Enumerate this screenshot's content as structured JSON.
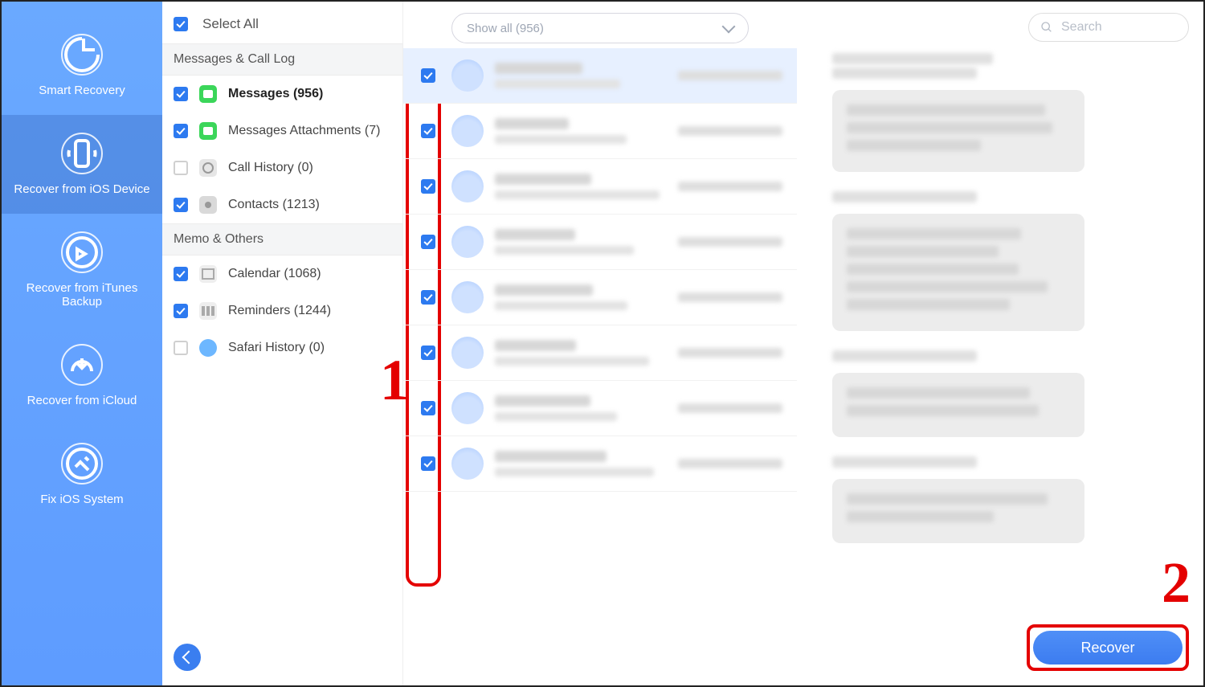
{
  "nav": {
    "items": [
      {
        "label": "Smart Recovery"
      },
      {
        "label": "Recover from iOS Device"
      },
      {
        "label": "Recover from iTunes Backup"
      },
      {
        "label": "Recover from iCloud"
      },
      {
        "label": "Fix iOS System"
      }
    ],
    "active_index": 1
  },
  "select_all": {
    "label": "Select All",
    "checked": true
  },
  "groups": [
    {
      "title": "Messages & Call Log",
      "items": [
        {
          "label": "Messages (956)",
          "checked": true,
          "bold": true,
          "icon": "msg"
        },
        {
          "label": "Messages Attachments (7)",
          "checked": true,
          "bold": false,
          "icon": "att"
        },
        {
          "label": "Call History (0)",
          "checked": false,
          "bold": false,
          "icon": "call"
        },
        {
          "label": "Contacts (1213)",
          "checked": true,
          "bold": false,
          "icon": "con"
        }
      ]
    },
    {
      "title": "Memo & Others",
      "items": [
        {
          "label": "Calendar (1068)",
          "checked": true,
          "bold": false,
          "icon": "cal"
        },
        {
          "label": "Reminders (1244)",
          "checked": true,
          "bold": false,
          "icon": "rem"
        },
        {
          "label": "Safari History (0)",
          "checked": false,
          "bold": false,
          "icon": "saf"
        }
      ]
    }
  ],
  "filter": {
    "label": "Show all (956)"
  },
  "message_rows": [
    {
      "checked": true,
      "selected": true
    },
    {
      "checked": true,
      "selected": false
    },
    {
      "checked": true,
      "selected": false
    },
    {
      "checked": true,
      "selected": false
    },
    {
      "checked": true,
      "selected": false
    },
    {
      "checked": true,
      "selected": false
    },
    {
      "checked": true,
      "selected": false
    },
    {
      "checked": true,
      "selected": false
    }
  ],
  "search": {
    "placeholder": "Search"
  },
  "detail_bubbles": 4,
  "recover_button": "Recover",
  "annotations": {
    "one": "1",
    "two": "2"
  }
}
